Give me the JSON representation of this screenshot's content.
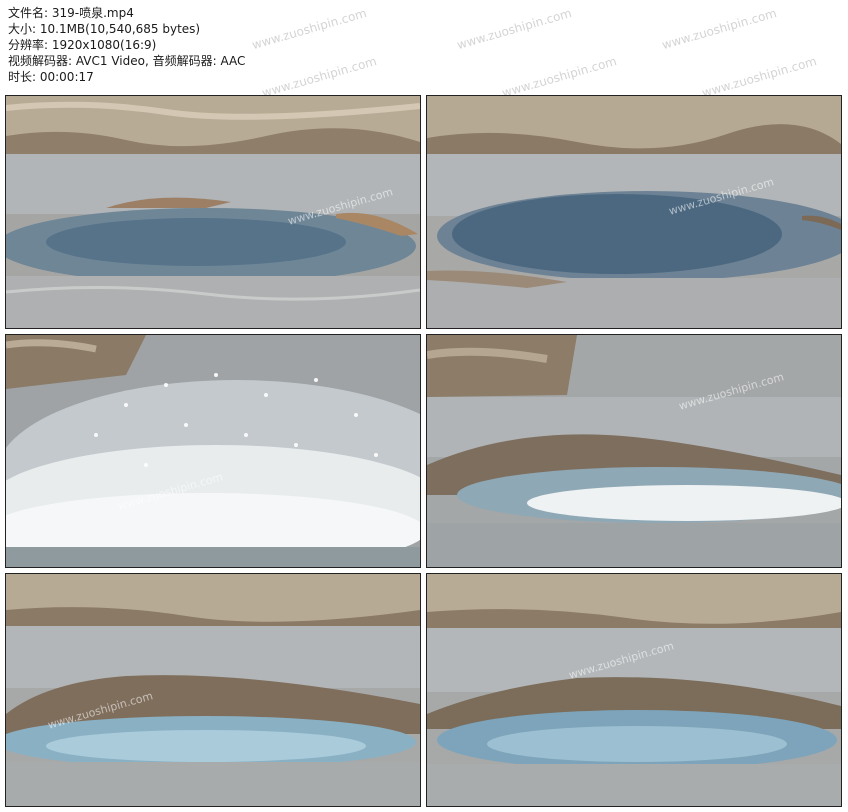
{
  "file_info": {
    "filename": "文件名: 319-喷泉.mp4",
    "size": "大小: 10.1MB(10,540,685 bytes)",
    "resolution": "分辨率: 1920x1080(16:9)",
    "codecs": "视频解码器: AVC1 Video, 音频解码器: AAC",
    "duration": "时长: 00:00:17"
  },
  "watermark": "www.zuoshipin.com",
  "colors": {
    "rock": "#b9ab96",
    "rock_dark": "#7a6a58",
    "water": "#9aa3a8",
    "pool": "#6f8697",
    "pool_deep": "#4f6a7e",
    "splash": "#f2f4f5",
    "frame_border": "#222222"
  }
}
